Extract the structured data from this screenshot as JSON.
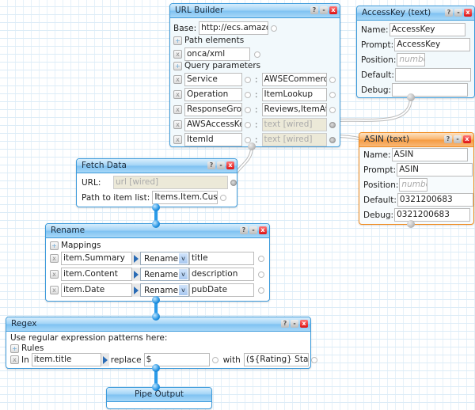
{
  "modules": {
    "url_builder": {
      "title": "URL Builder",
      "base_label": "Base:",
      "base_value": "http://ecs.amazon",
      "path_section": "Path elements",
      "path_elements": [
        "onca/xml"
      ],
      "query_section": "Query parameters",
      "query_params": [
        {
          "key": "Service",
          "value": "AWSECommerce",
          "wired": false
        },
        {
          "key": "Operation",
          "value": "ItemLookup",
          "wired": false
        },
        {
          "key": "ResponseGroup",
          "value": "Reviews,ItemAttrib",
          "wired": false
        },
        {
          "key": "AWSAccessKe",
          "value": "text [wired]",
          "wired": true
        },
        {
          "key": "ItemId",
          "value": "text [wired]",
          "wired": true
        }
      ]
    },
    "access_key": {
      "title": "AccessKey (text)",
      "name_label": "Name:",
      "name_value": "AccessKey",
      "prompt_label": "Prompt:",
      "prompt_value": "AccessKey",
      "position_label": "Position:",
      "position_placeholder": "numbe.",
      "default_label": "Default:",
      "default_value": "",
      "debug_label": "Debug:",
      "debug_value": ""
    },
    "asin": {
      "title": "ASIN (text)",
      "name_label": "Name:",
      "name_value": "ASIN",
      "prompt_label": "Prompt:",
      "prompt_value": "ASIN",
      "position_label": "Position:",
      "position_placeholder": "numbe.",
      "default_label": "Default:",
      "default_value": "0321200683",
      "debug_label": "Debug:",
      "debug_value": "0321200683"
    },
    "fetch_data": {
      "title": "Fetch Data",
      "url_label": "URL:",
      "url_value": "url [wired]",
      "path_label": "Path to item list:",
      "path_value": "Items.Item.Custor"
    },
    "rename": {
      "title": "Rename",
      "section": "Mappings",
      "mappings": [
        {
          "field": "item.Summary",
          "op": "Rename",
          "target": "title"
        },
        {
          "field": "item.Content",
          "op": "Rename",
          "target": "description"
        },
        {
          "field": "item.Date",
          "op": "Rename",
          "target": "pubDate"
        }
      ]
    },
    "regex": {
      "title": "Regex",
      "hint": "Use regular expression patterns here:",
      "section": "Rules",
      "rule": {
        "in_label": "In",
        "field": "item.title",
        "replace_label": "replace",
        "pattern": "$",
        "with_label": "with",
        "replacement": "(${Rating} Stars)"
      }
    },
    "pipe_output": {
      "title": "Pipe Output"
    }
  },
  "titlebar_buttons": {
    "help": "?",
    "minimize": "-",
    "close": "x"
  },
  "icons": {
    "add": "+",
    "remove": "x",
    "chevron": "v"
  },
  "colors": {
    "module_border": "#3d9bdb",
    "selected_border": "#f08a1c",
    "wired_bg": "#ece9d8"
  }
}
